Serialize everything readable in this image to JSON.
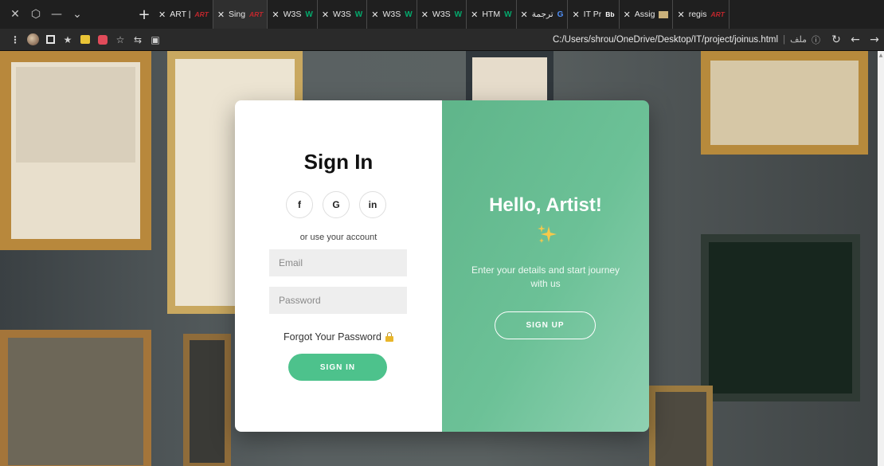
{
  "browser": {
    "window_controls": [
      "✕",
      "⬡",
      "—",
      "⌄"
    ],
    "new_tab": "+",
    "tabs": [
      {
        "title": "ART |",
        "favicon": "ART",
        "kind": "art",
        "active": false
      },
      {
        "title": "Sing",
        "favicon": "ART",
        "kind": "art",
        "active": true
      },
      {
        "title": "W3S",
        "favicon": "W",
        "kind": "w3",
        "active": false
      },
      {
        "title": "W3S",
        "favicon": "W",
        "kind": "w3",
        "active": false
      },
      {
        "title": "W3S",
        "favicon": "W",
        "kind": "w3",
        "active": false
      },
      {
        "title": "W3S",
        "favicon": "W",
        "kind": "w3",
        "active": false
      },
      {
        "title": "HTM",
        "favicon": "W",
        "kind": "w3",
        "active": false
      },
      {
        "title": "ترجمة",
        "favicon": "G",
        "kind": "gt",
        "active": false
      },
      {
        "title": "IT Pr",
        "favicon": "Bb",
        "kind": "bb",
        "active": false
      },
      {
        "title": "Assig",
        "favicon": "",
        "kind": "box",
        "active": false
      },
      {
        "title": "regis",
        "favicon": "ART",
        "kind": "art",
        "active": false
      }
    ],
    "tab_close": "✕",
    "address": {
      "url": "C:/Users/shrou/OneDrive/Desktop/IT/project/joinus.html",
      "label": "ملف",
      "info": "ⓘ"
    },
    "toolbar_glyphs": {
      "menu": "⋮",
      "pin": "★",
      "star": "☆",
      "folder": "⇆",
      "photo": "▣",
      "reload": "↻",
      "back": "←",
      "forward": "→"
    }
  },
  "signin": {
    "title": "Sign In",
    "socials": [
      "f",
      "G",
      "in"
    ],
    "alt_text": "or use your account",
    "email_placeholder": "Email",
    "password_placeholder": "Password",
    "forgot": "Forgot Your Password",
    "button": "SIGN IN"
  },
  "welcome": {
    "title": "Hello, Artist!",
    "text": "Enter your details and start journey with us",
    "button": "SIGN UP"
  },
  "colors": {
    "accent": "#4dc28c",
    "panel_start": "#5fb58a",
    "panel_end": "#8fd1b2"
  }
}
